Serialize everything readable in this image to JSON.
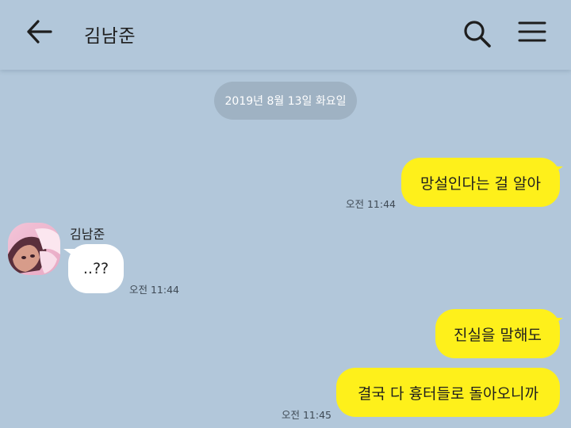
{
  "header": {
    "title": "김남준",
    "back_icon": "arrow-left-icon",
    "search_icon": "search-icon",
    "menu_icon": "hamburger-menu-icon"
  },
  "date_divider": "2019년 8월 13일 화요일",
  "messages": [
    {
      "sender": "me",
      "text": "망설인다는 걸 알아",
      "time": "오전 11:44"
    },
    {
      "sender": "other",
      "name": "김남준",
      "text": "..??",
      "time": "오전 11:44"
    },
    {
      "sender": "me",
      "text": "진실을 말해도",
      "time": ""
    },
    {
      "sender": "me",
      "text": "결국 다 흉터들로 돌아오니까",
      "time": "오전 11:45"
    }
  ],
  "colors": {
    "background": "#b2c7da",
    "my_bubble": "#fef01b",
    "other_bubble": "#ffffff",
    "date_pill": "#9fb2c3"
  }
}
